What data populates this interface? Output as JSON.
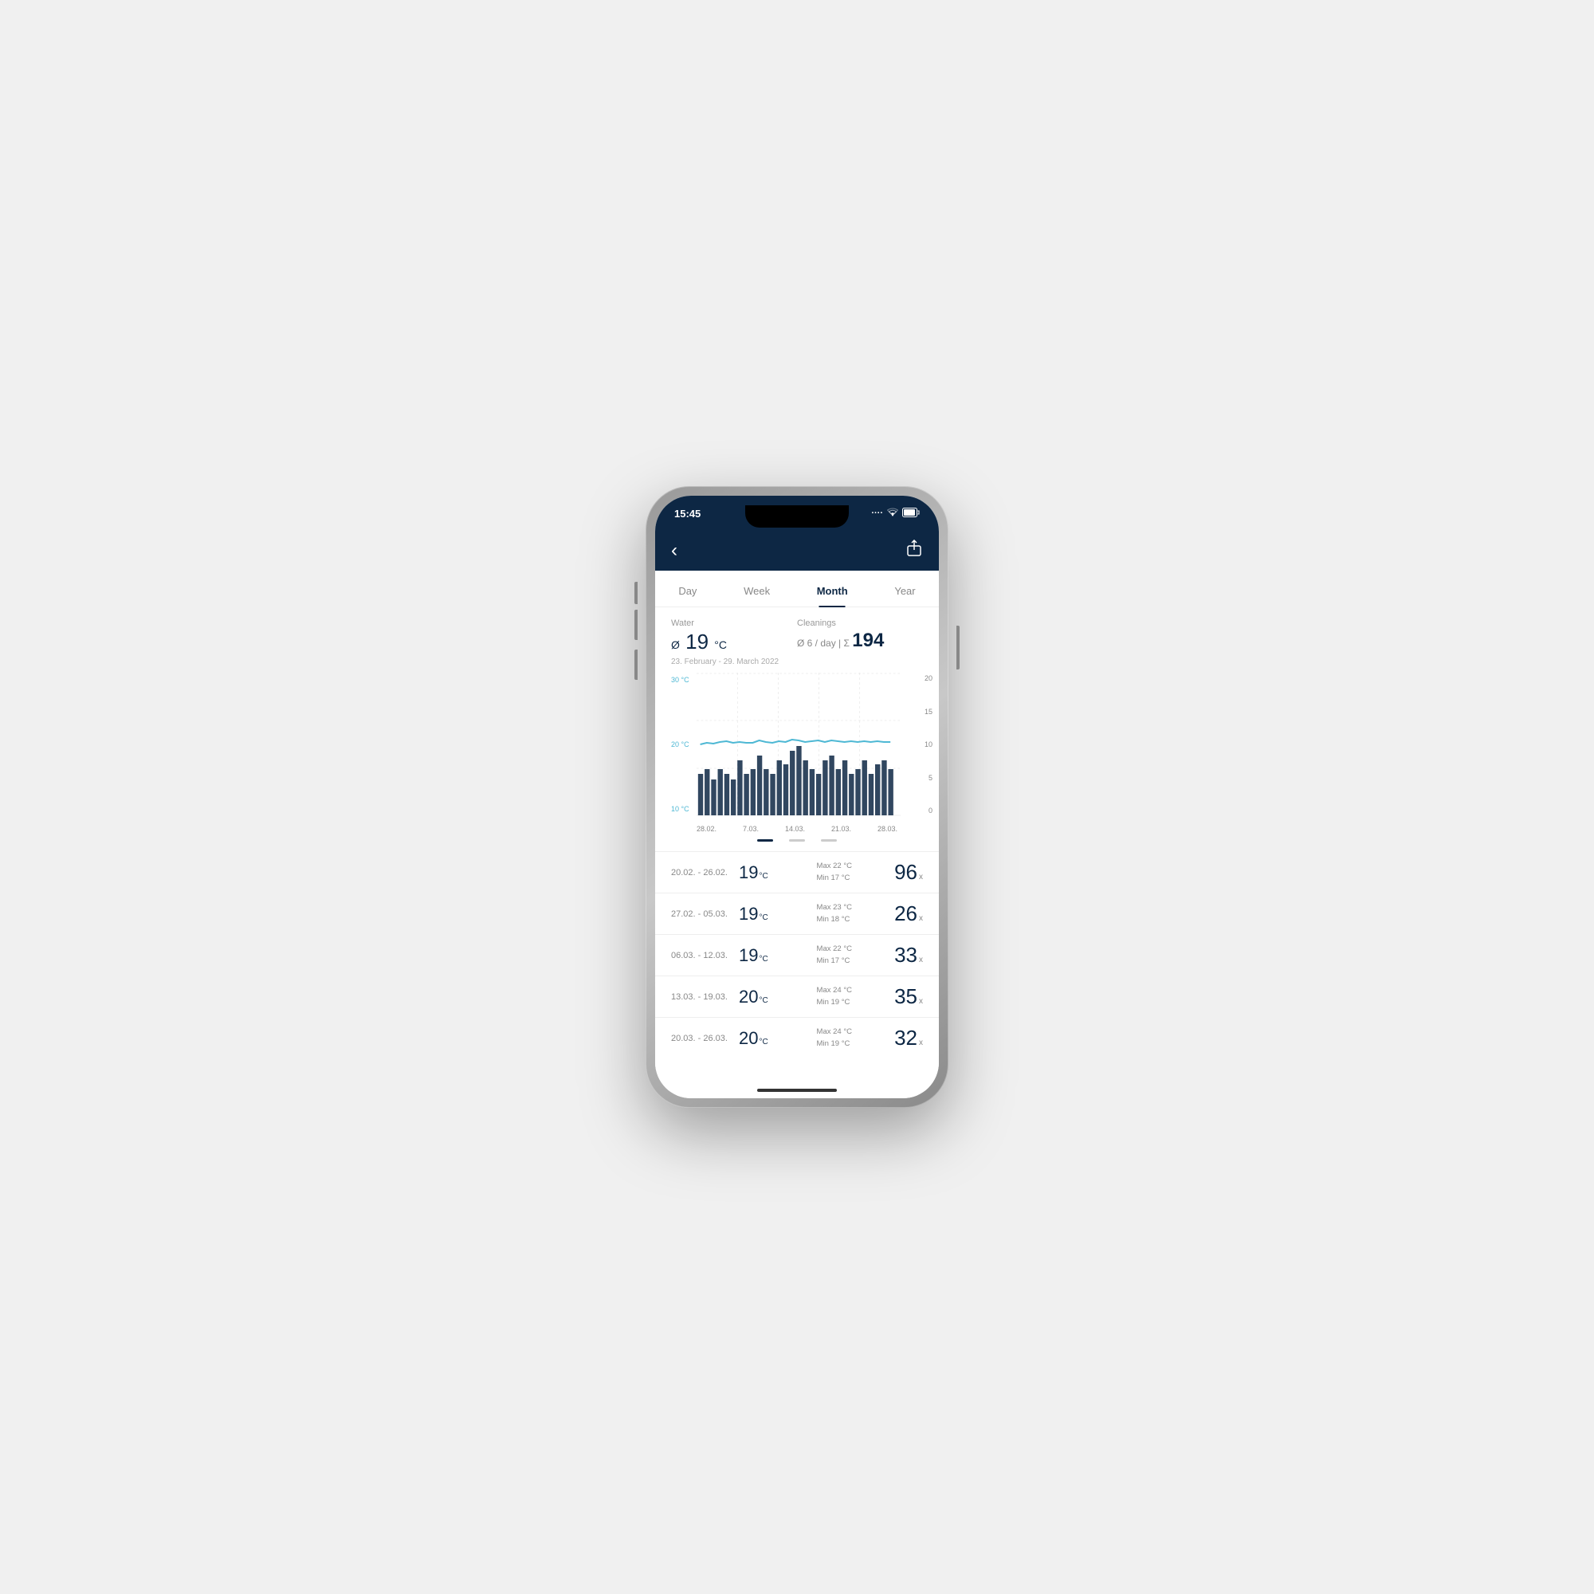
{
  "phone": {
    "status_bar": {
      "time": "15:45",
      "signal": "····",
      "wifi": "wifi",
      "battery": "battery"
    }
  },
  "header": {
    "back_label": "‹",
    "share_label": "⎋"
  },
  "tabs": {
    "items": [
      {
        "id": "day",
        "label": "Day",
        "active": false
      },
      {
        "id": "week",
        "label": "Week",
        "active": false
      },
      {
        "id": "month",
        "label": "Month",
        "active": true
      },
      {
        "id": "year",
        "label": "Year",
        "active": false
      }
    ]
  },
  "stats": {
    "water_label": "Water",
    "water_prefix": "Ø",
    "water_value": "19",
    "water_unit": "°C",
    "cleanings_label": "Cleanings",
    "cleanings_avg": "Ø 6 / day",
    "cleanings_sum_prefix": "Σ",
    "cleanings_sum": "194",
    "date_range": "23. February - 29. March 2022"
  },
  "chart": {
    "y_left_labels": [
      "30 °C",
      "20 °C",
      "10 °C"
    ],
    "y_right_labels": [
      "20",
      "15",
      "10",
      "5",
      "0"
    ],
    "x_labels": [
      "28.02.",
      "7.03.",
      "14.03.",
      "21.03.",
      "28.03."
    ],
    "bars": [
      6,
      7,
      5,
      7,
      6,
      5,
      8,
      6,
      7,
      9,
      7,
      6,
      8,
      7,
      9,
      10,
      8,
      7,
      6,
      8,
      9,
      7,
      8,
      6,
      7,
      8,
      6,
      7,
      8,
      7
    ],
    "line_points": [
      10,
      10.2,
      10.1,
      10.3,
      10.5,
      10.2,
      10.4,
      10.3,
      10.2,
      10.6,
      10.4,
      10.3,
      10.5,
      10.4,
      10.7,
      10.5,
      10.3,
      10.4,
      10.6,
      10.4,
      10.5,
      10.3,
      10.4,
      10.5,
      10.4,
      10.5,
      10.3,
      10.4,
      10.5,
      10.4
    ]
  },
  "table": {
    "rows": [
      {
        "date": "20.02. - 26.02.",
        "temp": "19",
        "unit": "°C",
        "max_label": "Max 22 °C",
        "min_label": "Min  17 °C",
        "count": "96",
        "count_unit": "x"
      },
      {
        "date": "27.02. - 05.03.",
        "temp": "19",
        "unit": "°C",
        "max_label": "Max 23 °C",
        "min_label": "Min  18 °C",
        "count": "26",
        "count_unit": "x"
      },
      {
        "date": "06.03. - 12.03.",
        "temp": "19",
        "unit": "°C",
        "max_label": "Max 22 °C",
        "min_label": "Min  17 °C",
        "count": "33",
        "count_unit": "x"
      },
      {
        "date": "13.03. - 19.03.",
        "temp": "20",
        "unit": "°C",
        "max_label": "Max 24 °C",
        "min_label": "Min  19 °C",
        "count": "35",
        "count_unit": "x"
      },
      {
        "date": "20.03. - 26.03.",
        "temp": "20",
        "unit": "°C",
        "max_label": "Max 24 °C",
        "min_label": "Min  19 °C",
        "count": "32",
        "count_unit": "x"
      }
    ]
  }
}
